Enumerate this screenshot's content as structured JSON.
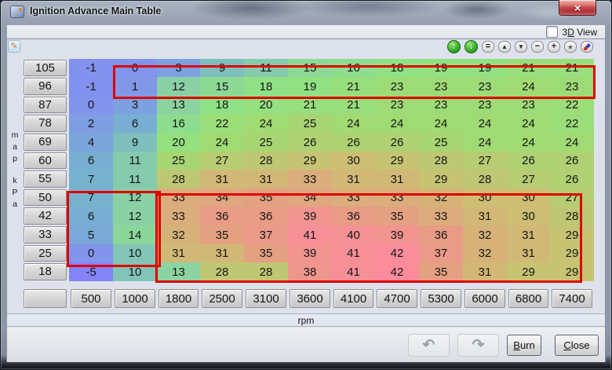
{
  "window": {
    "title": "Ignition Advance Main Table",
    "close_glyph": "×"
  },
  "view_toggle": {
    "pre": "3",
    "accel": "D",
    "post": " View"
  },
  "toolbar": {
    "edit_glyph": "✎",
    "icons": [
      {
        "name": "scale-up-button",
        "glyph": "↑",
        "type": "circle"
      },
      {
        "name": "scale-down-button",
        "glyph": "↓",
        "type": "circle"
      },
      {
        "name": "set-equal-button",
        "glyph": "=",
        "type": "flat"
      },
      {
        "name": "increase-button",
        "glyph": "▲",
        "type": "flat"
      },
      {
        "name": "decrease-button",
        "glyph": "▼",
        "type": "flat"
      },
      {
        "name": "minus-button",
        "glyph": "−",
        "type": "flat"
      },
      {
        "name": "plus-button",
        "glyph": "+",
        "type": "flat"
      },
      {
        "name": "interpolate-button",
        "glyph": "*",
        "type": "flat"
      },
      {
        "name": "smooth-button",
        "glyph": "",
        "type": "pencil"
      }
    ]
  },
  "table": {
    "x_axis_label": "rpm",
    "y_axis_label": "map kPa",
    "rpm_bins": [
      "500",
      "1000",
      "1800",
      "2500",
      "3100",
      "3600",
      "4100",
      "4700",
      "5300",
      "6000",
      "6800",
      "7400"
    ],
    "map_bins": [
      "105",
      "96",
      "87",
      "78",
      "69",
      "60",
      "55",
      "50",
      "42",
      "33",
      "25",
      "18"
    ],
    "values": [
      [
        -1,
        0,
        3,
        9,
        11,
        15,
        16,
        18,
        19,
        19,
        21,
        21
      ],
      [
        -1,
        1,
        12,
        15,
        18,
        19,
        21,
        23,
        23,
        23,
        24,
        23
      ],
      [
        0,
        3,
        13,
        18,
        20,
        21,
        21,
        23,
        23,
        23,
        23,
        22
      ],
      [
        2,
        6,
        16,
        22,
        24,
        25,
        24,
        24,
        24,
        24,
        24,
        22
      ],
      [
        4,
        9,
        20,
        24,
        25,
        26,
        26,
        26,
        25,
        24,
        24,
        24
      ],
      [
        6,
        11,
        25,
        27,
        28,
        29,
        30,
        29,
        28,
        27,
        26,
        26
      ],
      [
        7,
        11,
        28,
        31,
        31,
        33,
        31,
        31,
        29,
        28,
        27,
        26
      ],
      [
        7,
        12,
        33,
        34,
        35,
        34,
        33,
        33,
        32,
        30,
        30,
        27
      ],
      [
        6,
        12,
        33,
        36,
        36,
        39,
        36,
        35,
        33,
        31,
        30,
        28
      ],
      [
        5,
        14,
        32,
        35,
        37,
        41,
        40,
        39,
        36,
        32,
        31,
        29
      ],
      [
        0,
        10,
        31,
        31,
        35,
        39,
        41,
        42,
        37,
        32,
        31,
        29
      ],
      [
        -5,
        10,
        13,
        28,
        28,
        38,
        41,
        42,
        35,
        31,
        29,
        29
      ]
    ],
    "color_scale": {
      "stops": [
        {
          "v": -5,
          "c": "#8484f6"
        },
        {
          "v": 0,
          "c": "#8294eb"
        },
        {
          "v": 7,
          "c": "#76b2cd"
        },
        {
          "v": 12,
          "c": "#8ad0a5"
        },
        {
          "v": 18,
          "c": "#8ee285"
        },
        {
          "v": 24,
          "c": "#a0da73"
        },
        {
          "v": 30,
          "c": "#cdbe73"
        },
        {
          "v": 36,
          "c": "#e89b85"
        },
        {
          "v": 42,
          "c": "#fa8c9b"
        }
      ]
    }
  },
  "highlights": {
    "color": "#dd0000",
    "rects": [
      {
        "name": "highlight-top-rows",
        "col_from": 1.03,
        "col_to": 12.01,
        "row_from": 0.42,
        "row_to": 2.1
      },
      {
        "name": "highlight-low-rpm-cells",
        "col_from": -0.03,
        "col_to": 2.07,
        "row_from": 7.2,
        "row_to": 11.2
      },
      {
        "name": "highlight-main-cells",
        "col_from": 2.0,
        "col_to": 11.7,
        "row_from": 7.35,
        "row_to": 12.05
      }
    ]
  },
  "actions": {
    "undo_glyph": "↶",
    "redo_glyph": "↷",
    "burn": {
      "accel": "B",
      "post": "urn"
    },
    "close": {
      "accel": "C",
      "post": "lose"
    }
  }
}
